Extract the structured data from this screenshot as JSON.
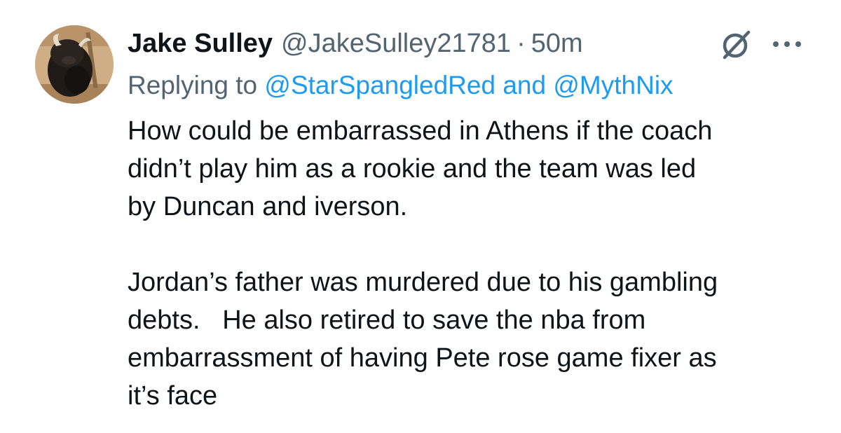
{
  "tweet": {
    "author_name": "Jake Sulley",
    "author_handle": "@JakeSulley21781",
    "separator": "·",
    "timestamp": "50m",
    "avatar_icon": "bison-avatar",
    "grok_icon": "grok-icon",
    "more_icon": "more-icon",
    "replying_to_prefix": "Replying to",
    "replying_mention_1": "@StarSpangledRed",
    "replying_conjunction": "and",
    "replying_mention_2": "@MythNix",
    "body_lines": [
      "How could be embarrassed in Athens if the coach",
      "didn’t play him as a rookie and the team was led",
      "by Duncan and iverson.",
      "Jordan’s father was murdered due to his gambling",
      "debts.   He also retired to save the nba from",
      "embarrassment of having Pete rose game fixer as",
      "it’s face"
    ]
  },
  "colors": {
    "text_primary": "#0f1419",
    "text_secondary": "#536471",
    "link": "#1d9bf0",
    "background": "#ffffff"
  }
}
